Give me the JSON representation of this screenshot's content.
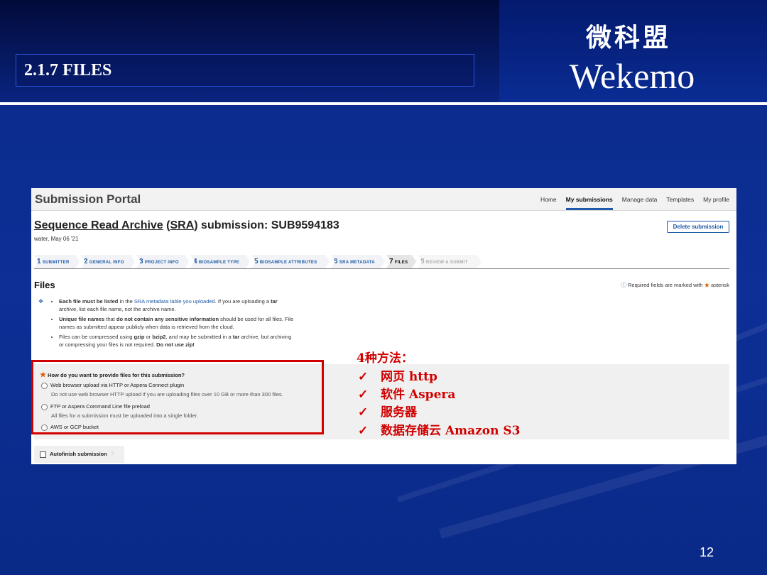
{
  "slide": {
    "section_title": "2.1.7 FILES",
    "brand_cn": "微科盟",
    "brand_en": "Wekemo",
    "page_number": "12"
  },
  "portal": {
    "title": "Submission Portal",
    "nav": [
      "Home",
      "My submissions",
      "Manage data",
      "Templates",
      "My profile"
    ],
    "active_nav": "My submissions",
    "submission": {
      "title_link_1": "Sequence Read Archive",
      "title_paren_open": " (",
      "title_link_2": "SRA",
      "title_rest": ") submission: SUB9594183",
      "meta": "water, May 06 '21",
      "delete_label": "Delete submission"
    },
    "steps": [
      {
        "num": "1",
        "label": "SUBMITTER"
      },
      {
        "num": "2",
        "label": "GENERAL INFO"
      },
      {
        "num": "3",
        "label": "PROJECT INFO"
      },
      {
        "num": "4",
        "label": "BIOSAMPLE TYPE"
      },
      {
        "num": "5",
        "label": "BIOSAMPLE ATTRIBUTES"
      },
      {
        "num": "6",
        "label": "SRA METADATA"
      },
      {
        "num": "7",
        "label": "FILES"
      },
      {
        "num": "8",
        "label": "REVIEW & SUBMIT"
      }
    ],
    "files_heading": "Files",
    "required_note": "Required fields are marked with",
    "required_star": "★",
    "required_tail": "asterisk",
    "bullets": {
      "b1_bold": "Each file must be listed",
      "b1_mid": " in the ",
      "b1_link": "SRA metadata table you uploaded",
      "b1_tail": ". If you are uploading a ",
      "b1_tar": "tar",
      "b1_line2": "archive, list each file name, not the archive name.",
      "b2_bold": "Unique file names",
      "b2_mid": " that ",
      "b2_bold2": "do not contain any sensitive information",
      "b2_tail": " should be used for all files. File",
      "b2_line2": "names as submitted appear publicly when data is retrieved from the cloud.",
      "b3_a": "Files can be compressed using ",
      "b3_gzip": "gzip",
      "b3_or": " or ",
      "b3_bzip2": "bzip2",
      "b3_b": ", and may be submitted in a ",
      "b3_tar": "tar",
      "b3_c": " archive, but archiving",
      "b3_line2": "or compressing your files is not required. ",
      "b3_zip": "Do not use zip!"
    },
    "question": "How do you want to provide files for this submission?",
    "options": [
      {
        "label": "Web browser upload via HTTP or Aspera Connect plugin",
        "sub": "Do not use web browser HTTP upload if you are uploading files over 10 GB or more than 300 files."
      },
      {
        "label": "FTP or Aspera Command Line file preload",
        "sub": "All files for a submission must be uploaded into a single folder."
      },
      {
        "label": "AWS or GCP bucket",
        "sub": ""
      }
    ],
    "autofinish_label": "Autofinish submission"
  },
  "annotation": {
    "title": "4种方法：",
    "tick": "✓",
    "methods": [
      "网页 http",
      "软件 Aspera",
      "服务器",
      "数据存储云 Amazon S3"
    ]
  },
  "colors": {
    "slide_bg": "#0b2a8a",
    "annotation_red": "#d00000",
    "link_blue": "#1e5aa8",
    "required_orange": "#e05a00"
  }
}
